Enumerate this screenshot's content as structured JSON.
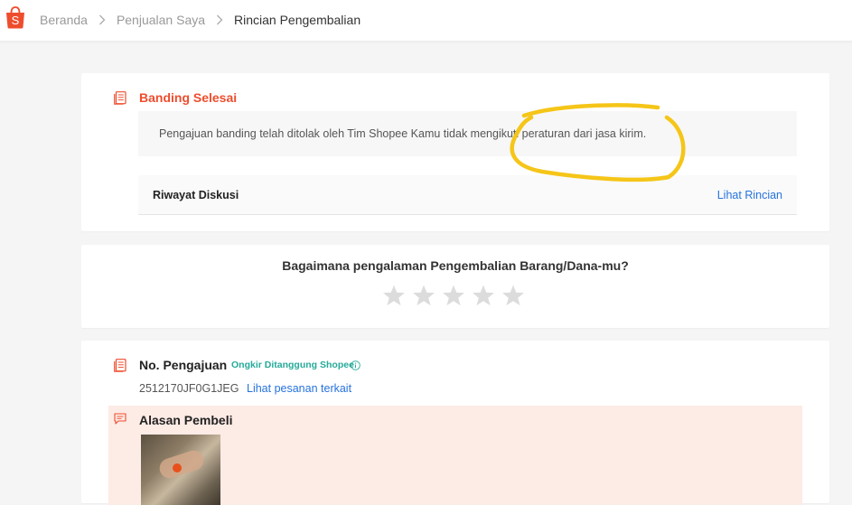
{
  "breadcrumb": {
    "home": "Beranda",
    "sales": "Penjualan Saya",
    "current": "Rincian Pengembalian"
  },
  "appeal": {
    "status_title": "Banding Selesai",
    "note": "Pengajuan banding telah ditolak oleh Tim Shopee Kamu tidak mengikuti peraturan dari jasa kirim.",
    "history_label": "Riwayat Diskusi",
    "history_link": "Lihat Rincian"
  },
  "rating": {
    "question": "Bagaimana pengalaman Pengembalian Barang/Dana-mu?",
    "stars": 5,
    "selected": 0
  },
  "request": {
    "label": "No. Pengajuan",
    "badge": "Ongkir Ditanggung Shopee",
    "id": "2512170JF0G1JEG",
    "order_link": "Lihat pesanan terkait"
  },
  "buyer_reason": {
    "label": "Alasan Pembeli"
  },
  "colors": {
    "brand": "#ee4d2d",
    "link": "#2673dd",
    "badge": "#26aa99",
    "annotation": "#f5c518",
    "reason_bg": "#fdebe6"
  },
  "icons": {
    "logo": "shopee-bag-icon",
    "breadcrumb_separator": "chevron-right-icon",
    "section": "document-icon",
    "info": "info-icon",
    "reason": "chat-bubble-icon",
    "star": "star-icon"
  }
}
